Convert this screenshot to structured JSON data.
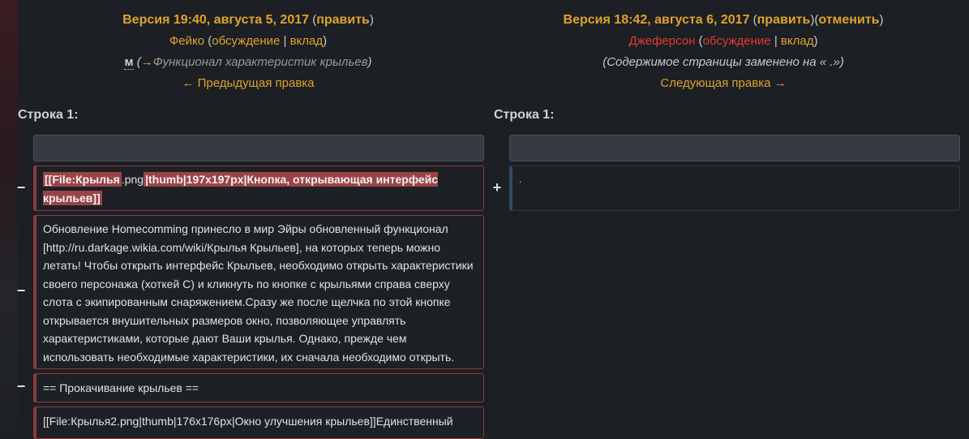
{
  "left": {
    "version": "Версия 19:40, августа 5, 2017",
    "edit_link": "править",
    "author": "Фейко",
    "talk_link": "обсуждение",
    "contrib_link": "вклад",
    "minor_mark": "м",
    "summary": "Функционал характеристик крыльев",
    "nav": "← Предыдущая правка",
    "line_label": "Строка 1:"
  },
  "right": {
    "version": "Версия 18:42, августа 6, 2017",
    "edit_link": "править",
    "undo_link": "отменить",
    "author": "Джеферсон",
    "talk_link": "обсуждение",
    "contrib_link": "вклад",
    "summary": "(Содержимое страницы заменено на « .»)",
    "nav": "Следующая правка →",
    "line_label": "Строка 1:",
    "added_text": "."
  },
  "diff": {
    "removed_1_parts": [
      "[[File:Крылья",
      ".png",
      "|thumb|197x197px|Кнопка, открывающая интерфейс крыльев]]"
    ],
    "removed_2": "Обновление Homecomming принесло в мир Эйры обновленный функционал [http://ru.darkage.wikia.com/wiki/Крылья Крыльев], на которых теперь можно летать! Чтобы открыть интерфейс Крыльев, необходимо открыть характеристики своего персонажа (хоткей C) и кликнуть по кнопке с крыльями справа сверху слота с экипированным снаряжением.Сразу же после щелчка по этой кнопке открывается внушительных размеров окно, позволяющее управлять характеристиками, которые дают Ваши крылья. Однако, прежде чем использовать необходимые характеристики, их сначала необходимо открыть.",
    "removed_3": "== Прокачивание крыльев ==",
    "removed_4": "[[File:Крылья2.png|thumb|176x176px|Окно улучшения крыльев]]Единственный",
    "minus": "−",
    "plus": "+"
  }
}
